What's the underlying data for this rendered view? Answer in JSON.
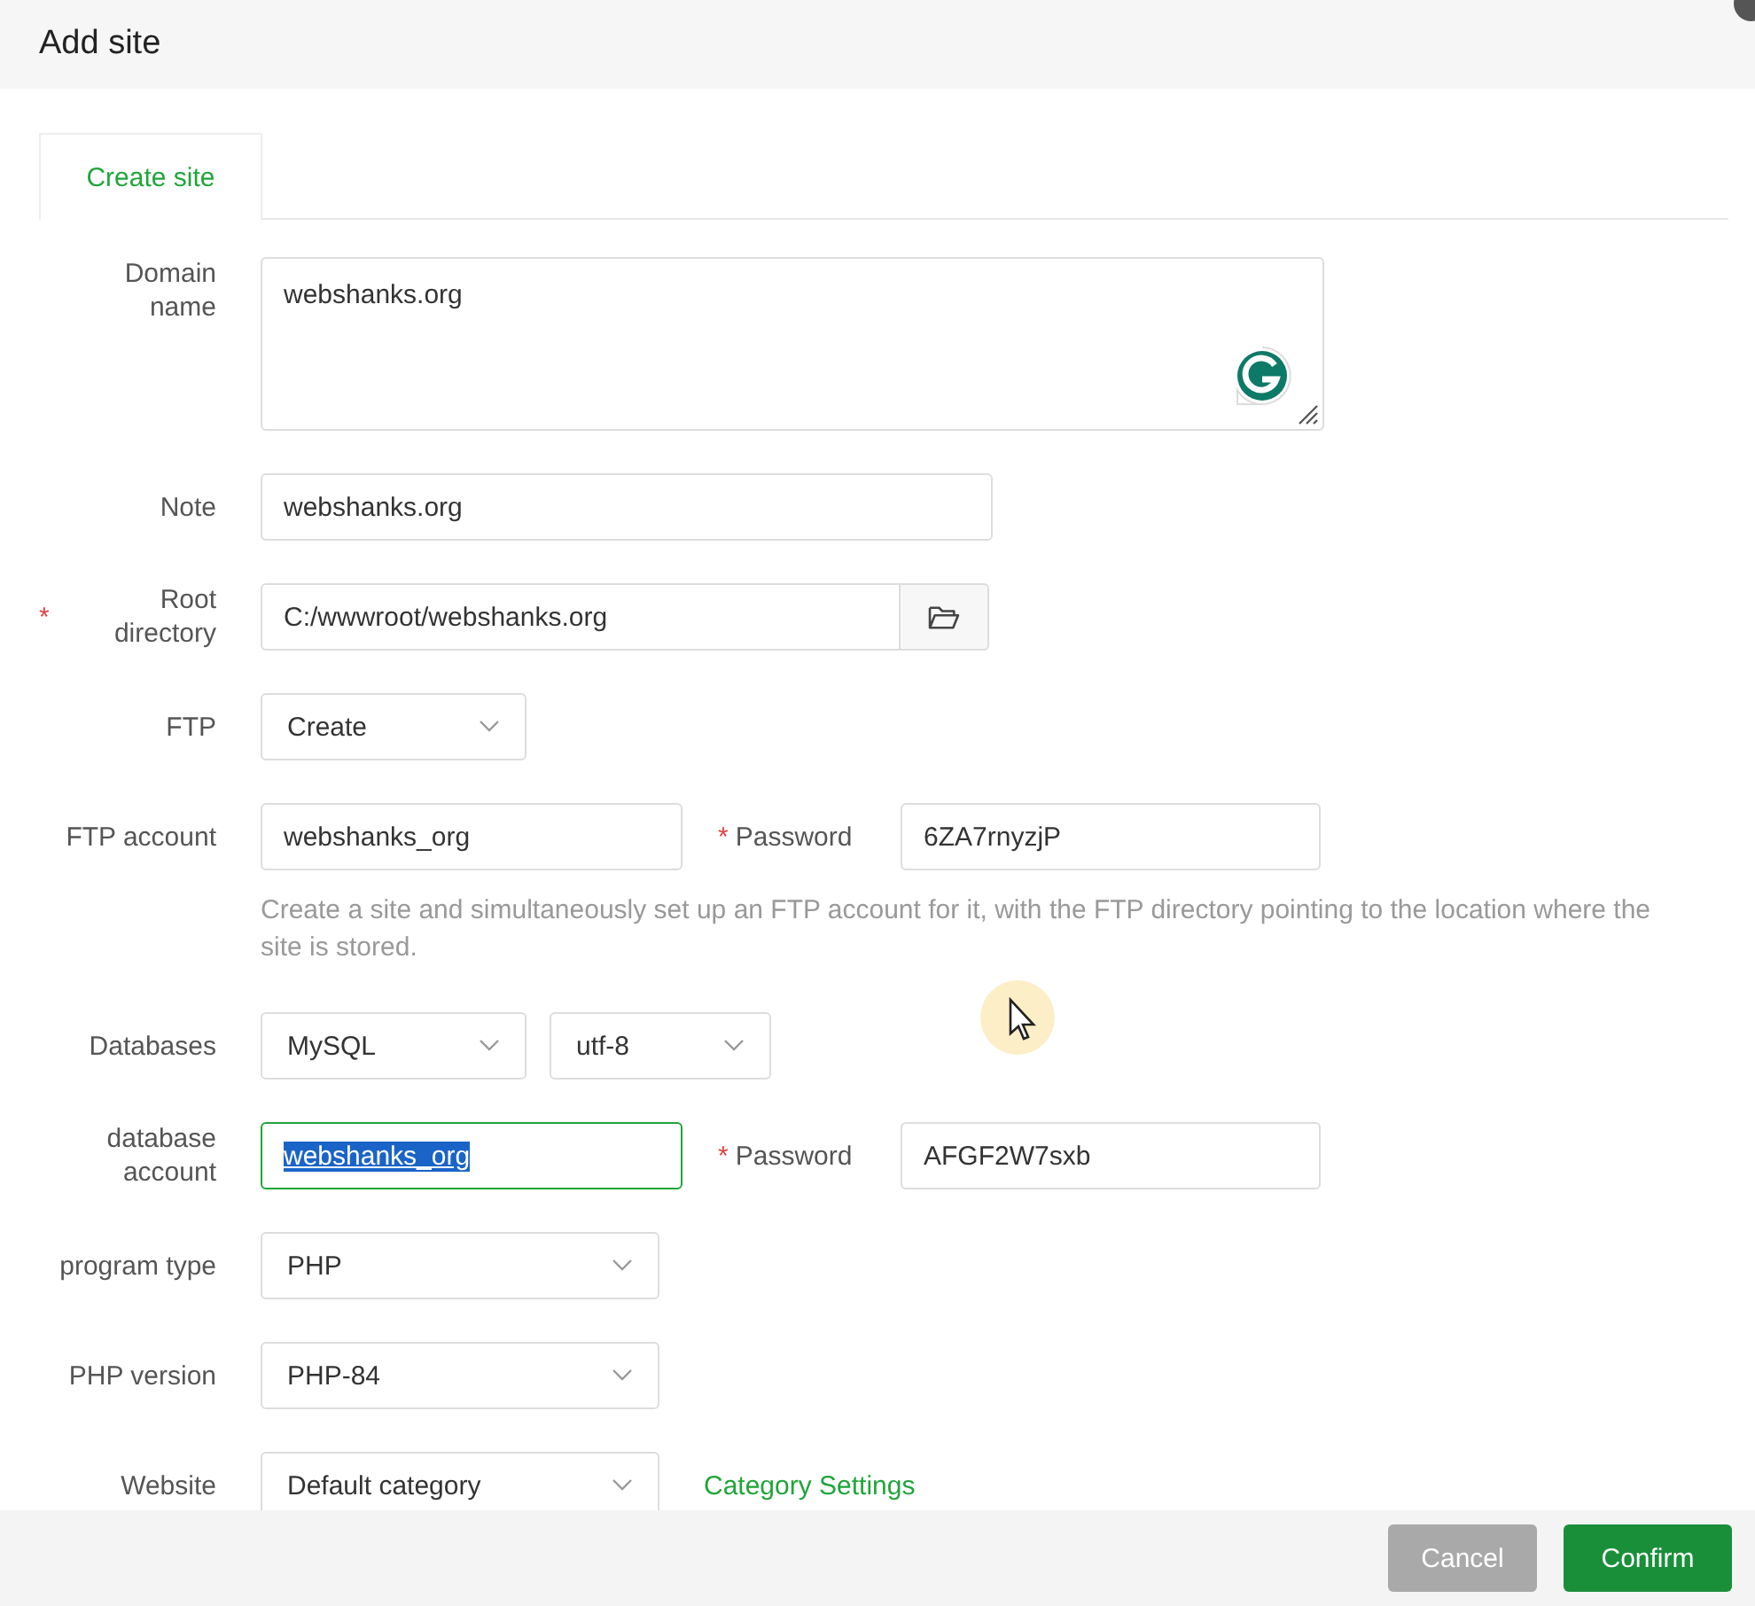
{
  "dialog": {
    "title": "Add site"
  },
  "tabs": [
    {
      "label": "Create site",
      "selected": true
    }
  ],
  "rows": [
    {
      "kind": "textarea",
      "label": [
        "Domain",
        "name"
      ],
      "value": "webshanks.org"
    },
    {
      "kind": "text",
      "label": [
        "Note"
      ],
      "value": "webshanks.org"
    },
    {
      "kind": "path",
      "marker": "*",
      "label": [
        "Root",
        "directory"
      ],
      "value": "C:/wwwroot/webshanks.org"
    },
    {
      "kind": "select",
      "label": [
        "FTP"
      ],
      "value": "Create"
    },
    {
      "kind": "pair",
      "label": [
        "FTP account"
      ],
      "value": "webshanks_org",
      "focused": false,
      "second": {
        "marker": "*",
        "label": "Password",
        "value": "6ZA7rnyzjP"
      }
    },
    {
      "kind": "hint",
      "text": "Create a site and simultaneously set up an FTP account for it, with the FTP directory pointing to the location where the site is stored."
    },
    {
      "kind": "selects",
      "label": [
        "Databases"
      ],
      "values": [
        "MySQL",
        "utf-8"
      ]
    },
    {
      "kind": "pair",
      "label": [
        "database",
        "account"
      ],
      "value": "webshanks_org",
      "focused": true,
      "second": {
        "marker": "*",
        "label": "Password",
        "value": "AFGF2W7sxb"
      }
    },
    {
      "kind": "wide-select",
      "label": [
        "program type"
      ],
      "value": "PHP"
    },
    {
      "kind": "wide-select",
      "label": [
        "PHP version"
      ],
      "value": "PHP-84"
    },
    {
      "kind": "wide-select",
      "label": [
        "Website"
      ],
      "value": "Default category",
      "link": "Category Settings"
    }
  ],
  "buttons": [
    {
      "kind": "secondary",
      "label": "Cancel",
      "disabled": true
    },
    {
      "kind": "primary",
      "label": "Confirm",
      "disabled": false
    }
  ]
}
